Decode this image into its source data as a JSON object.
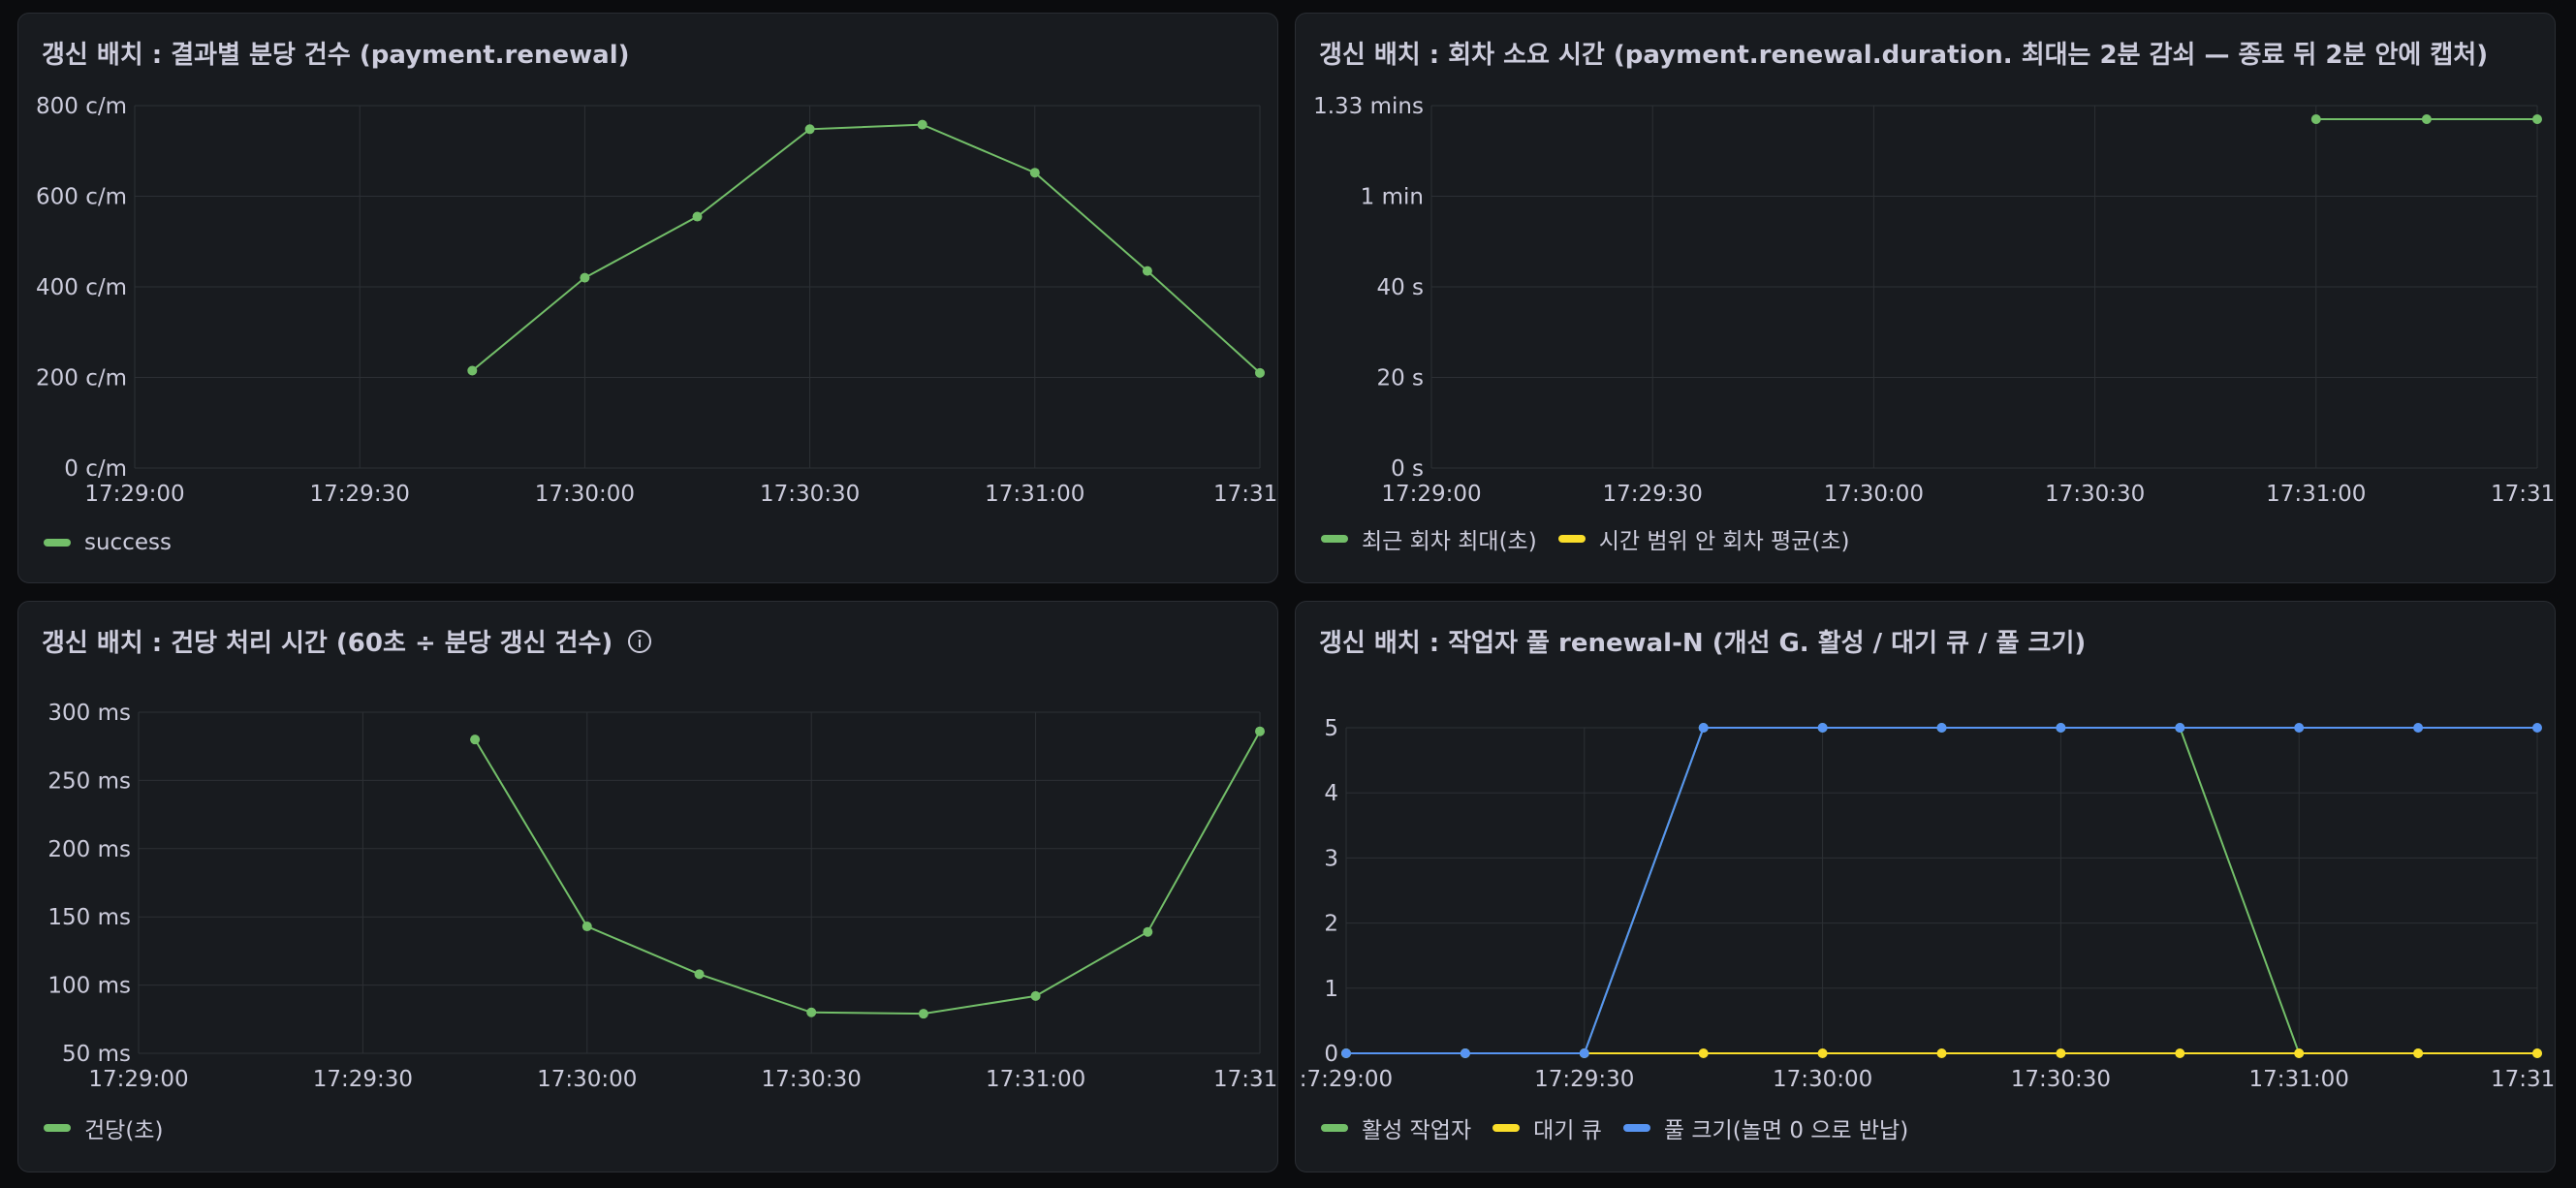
{
  "panels": [
    {
      "title": "갱신 배치 : 결과별 분당 건수 (payment.renewal)",
      "info": false
    },
    {
      "title": "갱신 배치 : 회차 소요 시간 (payment.renewal.duration. 최대는 2분 감쇠 — 종료 뒤 2분 안에 캡처)",
      "info": false
    },
    {
      "title": "갱신 배치 : 건당 처리 시간 (60초 ÷ 분당 갱신 건수)",
      "info": true
    },
    {
      "title": "갱신 배치 : 작업자 풀 renewal-N (개선 G. 활성 / 대기 큐 / 풀 크기)",
      "info": false
    }
  ],
  "colors": {
    "green": "#73bf69",
    "yellow": "#fade2a",
    "blue": "#5794f2",
    "grid": "#2c3035",
    "panel_bg": "#181b1f"
  },
  "chart_data": [
    {
      "type": "line",
      "title": "갱신 배치 : 결과별 분당 건수 (payment.renewal)",
      "unit": "c/m",
      "x_ticks": [
        "17:29:00",
        "17:29:30",
        "17:30:00",
        "17:30:30",
        "17:31:00",
        "17:31:"
      ],
      "y_ticks": [
        "0 c/m",
        "200 c/m",
        "400 c/m",
        "600 c/m",
        "800 c/m"
      ],
      "ylim": [
        0,
        800
      ],
      "x": [
        "17:29:45",
        "17:30:00",
        "17:30:15",
        "17:30:30",
        "17:30:45",
        "17:31:00",
        "17:31:15",
        "17:31:30"
      ],
      "series": [
        {
          "name": "success",
          "color": "#73bf69",
          "values": [
            215,
            420,
            555,
            748,
            758,
            652,
            435,
            210
          ]
        }
      ],
      "grid": true,
      "legend": "bottom-left"
    },
    {
      "type": "line",
      "title": "갱신 배치 : 회차 소요 시간 (payment.renewal.duration. 최대는 2분 감쇠 — 종료 뒤 2분 안에 캡처)",
      "unit": "s",
      "x_ticks": [
        "17:29:00",
        "17:29:30",
        "17:30:00",
        "17:30:30",
        "17:31:00",
        "17:31:"
      ],
      "y_ticks": [
        "0 s",
        "20 s",
        "40 s",
        "1 min",
        "1.33 mins"
      ],
      "ylim": [
        0,
        80
      ],
      "x": [
        "17:31:00",
        "17:31:15",
        "17:31:30"
      ],
      "series": [
        {
          "name": "최근 회차 최대(초)",
          "color": "#73bf69",
          "values": [
            77,
            77,
            77
          ]
        },
        {
          "name": "시간 범위 안 회차 평균(초)",
          "color": "#fade2a",
          "values": []
        }
      ],
      "grid": true,
      "legend": "bottom-left"
    },
    {
      "type": "line",
      "title": "갱신 배치 : 건당 처리 시간 (60초 ÷ 분당 갱신 건수)",
      "unit": "ms",
      "x_ticks": [
        "17:29:00",
        "17:29:30",
        "17:30:00",
        "17:30:30",
        "17:31:00",
        "17:31:"
      ],
      "y_ticks": [
        "50 ms",
        "100 ms",
        "150 ms",
        "200 ms",
        "250 ms",
        "300 ms"
      ],
      "ylim": [
        50,
        300
      ],
      "x": [
        "17:29:45",
        "17:30:00",
        "17:30:15",
        "17:30:30",
        "17:30:45",
        "17:31:00",
        "17:31:15",
        "17:31:30"
      ],
      "series": [
        {
          "name": "건당(초)",
          "color": "#73bf69",
          "values": [
            280,
            143,
            108,
            80,
            79,
            92,
            139,
            286
          ]
        }
      ],
      "grid": true,
      "legend": "bottom-left"
    },
    {
      "type": "line",
      "title": "갱신 배치 : 작업자 풀 renewal-N (개선 G. 활성 / 대기 큐 / 풀 크기)",
      "unit": "",
      "x_ticks": ":7:29:00",
      "x_tick_labels": [
        ":7:29:00",
        "17:29:30",
        "17:30:00",
        "17:30:30",
        "17:31:00",
        "17:31:"
      ],
      "y_ticks": [
        "0",
        "1",
        "2",
        "3",
        "4",
        "5"
      ],
      "ylim": [
        0,
        5
      ],
      "x": [
        "17:29:00",
        "17:29:15",
        "17:29:30",
        "17:29:45",
        "17:30:00",
        "17:30:15",
        "17:30:30",
        "17:30:45",
        "17:31:00",
        "17:31:15",
        "17:31:30"
      ],
      "series": [
        {
          "name": "활성 작업자",
          "color": "#73bf69",
          "values": [
            0,
            0,
            0,
            5,
            5,
            5,
            5,
            5,
            0,
            0,
            0
          ]
        },
        {
          "name": "대기 큐",
          "color": "#fade2a",
          "values": [
            0,
            0,
            0,
            0,
            0,
            0,
            0,
            0,
            0,
            0,
            0
          ]
        },
        {
          "name": "풀 크기(놀면 0 으로 반납)",
          "color": "#5794f2",
          "values": [
            0,
            0,
            0,
            5,
            5,
            5,
            5,
            5,
            5,
            5,
            5
          ]
        }
      ],
      "grid": true,
      "legend": "bottom-left"
    }
  ]
}
